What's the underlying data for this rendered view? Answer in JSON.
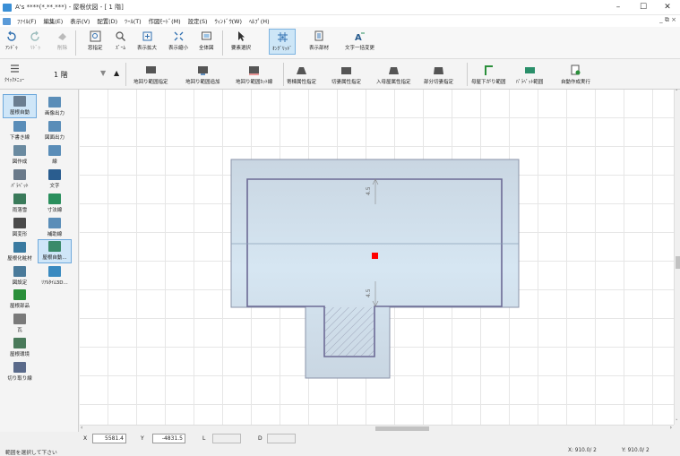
{
  "window": {
    "title": "A's ****(*.**.***) - 屋根伏図 - [ 1 階]",
    "controls": [
      "–",
      "☐",
      "✕"
    ],
    "mdi_controls": "_ ⧉ ×"
  },
  "menu": [
    "ﾌｧｲﾙ(F)",
    "編集(E)",
    "表示(V)",
    "配置(D)",
    "ﾂｰﾙ(T)",
    "作図ﾓｰﾄﾞ(M)",
    "設定(S)",
    "ｳｨﾝﾄﾞｳ(W)",
    "ﾍﾙﾌﾟ(H)"
  ],
  "toolbar1": {
    "undo": "ｱﾝﾄﾞｩ",
    "redo": "ﾘﾄﾞｩ",
    "delete": "削除",
    "window_select": "窓指定",
    "zoom": "ｽﾞｰﾑ",
    "zoom_in": "表示拡大",
    "zoom_out": "表示縮小",
    "full_view": "全体図",
    "element_select": "要素選択",
    "ortho_grid": "ｵﾝｸﾞﾘｯﾄﾞ",
    "display_parts": "表示部材",
    "text_batch": "文字一括変更"
  },
  "toolbar2": {
    "quick_menu": "ｸｲｯｸﾒﾆｭｰ",
    "floor": "1 階",
    "floor_down": "▼",
    "floor_up": "▲",
    "buttons": [
      "地回り範囲指定",
      "地回り範囲追加",
      "地回り範囲ｶｯﾄ線",
      "寄棟属性指定",
      "切妻属性指定",
      "入母屋属性指定",
      "部分切妻指定",
      "母屋下がり範囲",
      "ﾊﾟﾗﾍﾟｯﾄ範囲",
      "自動作成実行"
    ]
  },
  "sidebar": {
    "items": [
      {
        "label": "屋根自動",
        "active": true
      },
      {
        "label": "画像出力",
        "active": false
      },
      {
        "label": "下書き線",
        "active": false
      },
      {
        "label": "図面出力",
        "active": false
      },
      {
        "label": "図作成",
        "active": false
      },
      {
        "label": "線",
        "active": false
      },
      {
        "label": "ﾊﾟﾗﾍﾟｯﾄ",
        "active": false
      },
      {
        "label": "文字",
        "active": false
      },
      {
        "label": "雨落雪",
        "active": false
      },
      {
        "label": "寸法線",
        "active": false
      },
      {
        "label": "図変形",
        "active": false
      },
      {
        "label": "補助線",
        "active": false
      },
      {
        "label": "屋根化粧材",
        "active": false
      },
      {
        "label": "屋根自動...",
        "active": true
      },
      {
        "label": "図設定",
        "active": false
      },
      {
        "label": "ﾘｱﾙﾀｲﾑ3D...",
        "active": false
      },
      {
        "label": "屋根部品",
        "active": false
      },
      {
        "label": "瓦",
        "active": false
      },
      {
        "label": "屋根環境",
        "active": false
      },
      {
        "label": "切り取り線",
        "active": false
      }
    ]
  },
  "drawing": {
    "dim_top": "4.5",
    "dim_bottom": "4.5",
    "roof_fill": "#c8d8e6",
    "marker_color": "#ff0000"
  },
  "coords": {
    "x_label": "X",
    "x_value": "5581.4",
    "y_label": "Y",
    "y_value": "-4831.5",
    "l_label": "L",
    "l_value": "",
    "d_label": "D",
    "d_value": ""
  },
  "status": {
    "message": "範囲を選択して下さい",
    "x_grid": "X: 910.0/ 2",
    "y_grid": "Y: 910.0/ 2"
  }
}
